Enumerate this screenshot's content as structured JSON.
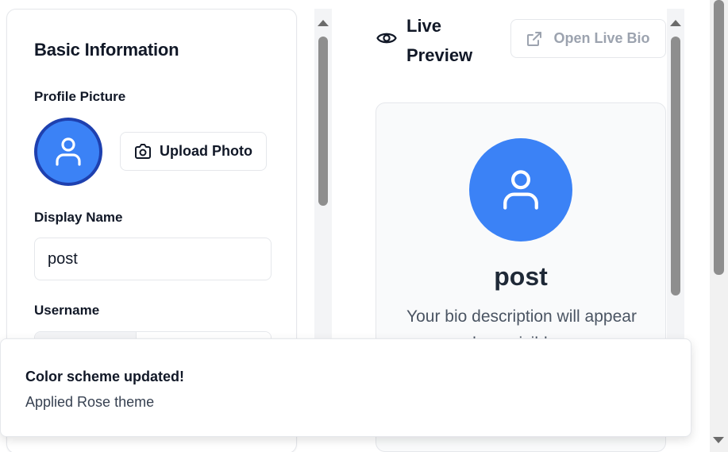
{
  "basic_info": {
    "title": "Basic Information",
    "profile_picture_label": "Profile Picture",
    "upload_button_label": "Upload Photo",
    "display_name_label": "Display Name",
    "display_name_value": "post",
    "username_label": "Username"
  },
  "preview": {
    "title": "Live Preview",
    "open_button_label": "Open Live Bio",
    "name": "post",
    "bio": "Your bio description will appear here visible..."
  },
  "toast": {
    "title": "Color scheme updated!",
    "description": "Applied Rose theme"
  },
  "colors": {
    "accent": "#3b82f6",
    "avatar_ring": "#1e40af"
  },
  "icons": {
    "camera": "camera-icon",
    "eye": "eye-icon",
    "external": "external-link-icon",
    "user": "user-icon"
  }
}
